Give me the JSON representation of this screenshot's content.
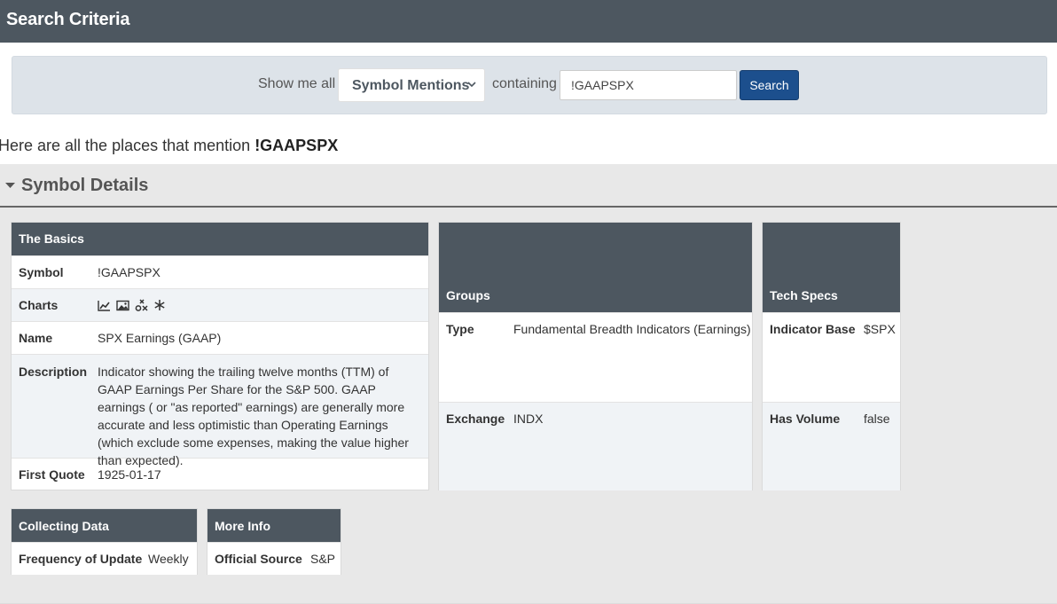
{
  "header": {
    "title": "Search Criteria"
  },
  "search": {
    "show_label": "Show me all",
    "select_value": "Symbol Mentions",
    "containing_label": "containing",
    "input_value": "!GAAPSPX",
    "button_label": "Search"
  },
  "mentions": {
    "prefix": "Here are all the places that mention",
    "symbol": "!GAAPSPX"
  },
  "symbol_details": {
    "title": "Symbol Details"
  },
  "basics": {
    "title": "The Basics",
    "rows": [
      {
        "label": "Symbol",
        "value": "!GAAPSPX"
      },
      {
        "label": "Charts",
        "icons": [
          "line-chart-icon",
          "image-icon",
          "point-figure-icon",
          "seasonality-icon"
        ]
      },
      {
        "label": "Name",
        "value": "SPX Earnings (GAAP)"
      },
      {
        "label": "Description",
        "value": "Indicator showing the trailing twelve months (TTM) of GAAP Earnings Per Share for the S&P 500. GAAP earnings ( or \"as reported\" earnings) are generally more accurate and less optimistic than Operating Earnings (which exclude some expenses, making the value higher than expected)."
      },
      {
        "label": "First Quote",
        "value": "1925-01-17"
      }
    ]
  },
  "groups": {
    "title": "Groups",
    "rows": [
      {
        "label": "Type",
        "value": "Fundamental Breadth Indicators (Earnings)"
      },
      {
        "label": "Exchange",
        "value": "INDX"
      }
    ]
  },
  "tech_specs": {
    "title": "Tech Specs",
    "rows": [
      {
        "label": "Indicator Base",
        "value": "$SPX"
      },
      {
        "label": "Has Volume",
        "value": "false"
      }
    ]
  },
  "collecting": {
    "title": "Collecting Data",
    "rows": [
      {
        "label": "Frequency of Update",
        "value": "Weekly"
      }
    ]
  },
  "more_info": {
    "title": "More Info",
    "rows": [
      {
        "label": "Official Source",
        "value": "S&P"
      }
    ]
  },
  "colors": {
    "header_bg": "#4d5760",
    "search_button": "#1c4f8d",
    "panel_bg": "#dde3e9"
  }
}
